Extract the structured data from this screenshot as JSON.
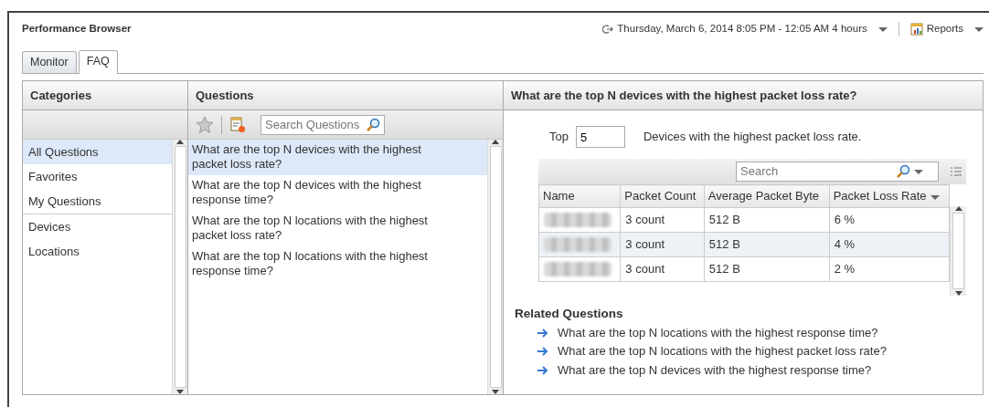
{
  "window": {
    "title": "Performance Browser"
  },
  "time_range": {
    "text": "Thursday, March 6, 2014 8:05 PM - 12:05 AM 4 hours"
  },
  "reports_menu": {
    "label": "Reports"
  },
  "tabs": [
    {
      "label": "Monitor",
      "selected": false
    },
    {
      "label": "FAQ",
      "selected": true
    }
  ],
  "categories": {
    "title": "Categories",
    "groups": [
      {
        "items": [
          {
            "label": "All Questions",
            "selected": true
          },
          {
            "label": "Favorites",
            "selected": false
          },
          {
            "label": "My Questions",
            "selected": false
          }
        ]
      },
      {
        "items": [
          {
            "label": "Devices",
            "selected": false
          },
          {
            "label": "Locations",
            "selected": false
          }
        ]
      }
    ]
  },
  "questions": {
    "title": "Questions",
    "search": {
      "placeholder": "Search Questions"
    },
    "items": [
      {
        "text": "What are the top N devices with the highest packet loss rate?",
        "selected": true
      },
      {
        "text": "What are the top N devices with the highest response time?",
        "selected": false
      },
      {
        "text": "What are the top N locations with the highest packet loss rate?",
        "selected": false
      },
      {
        "text": "What are the top N locations with the highest response time?",
        "selected": false
      }
    ]
  },
  "answer": {
    "title": "What are the top N devices with the highest packet loss rate?",
    "top_label": "Top",
    "top_value": "5",
    "top_suffix": "Devices with the highest packet loss rate.",
    "table": {
      "search": {
        "placeholder": "Search"
      },
      "columns": [
        {
          "label": "Name",
          "sorted": false
        },
        {
          "label": "Packet Count",
          "sorted": false
        },
        {
          "label": "Average Packet Byte",
          "sorted": false
        },
        {
          "label": "Packet Loss Rate",
          "sorted": true
        }
      ],
      "rows": [
        {
          "name_redacted": true,
          "cells": [
            "",
            "3 count",
            "512 B",
            "6 %"
          ]
        },
        {
          "name_redacted": true,
          "cells": [
            "",
            "3 count",
            "512 B",
            "4 %"
          ]
        },
        {
          "name_redacted": true,
          "cells": [
            "",
            "3 count",
            "512 B",
            "2 %"
          ]
        }
      ]
    },
    "related": {
      "title": "Related Questions",
      "items": [
        "What are the top N locations with the highest response time?",
        "What are the top N locations with the highest packet loss rate?",
        "What are the top N devices with the highest response time?"
      ]
    }
  }
}
